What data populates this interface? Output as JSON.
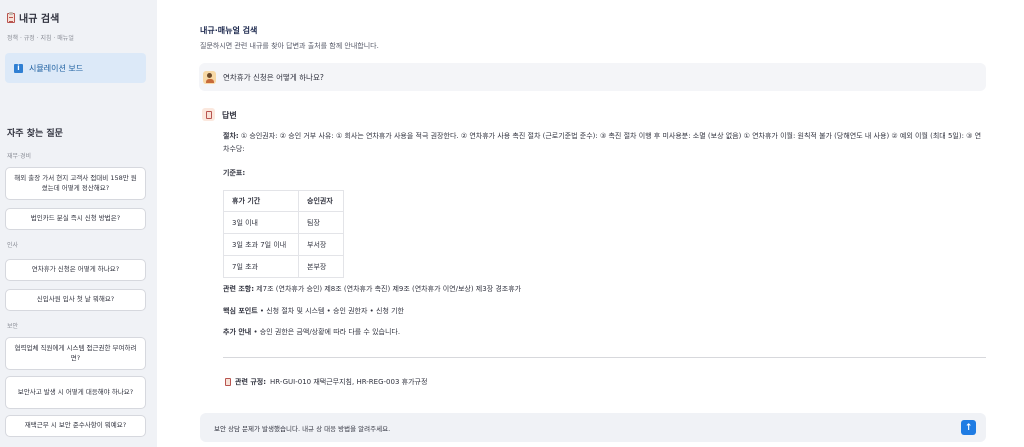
{
  "sidebar": {
    "title": "내규 검색",
    "subtitle": "정책 · 규정 · 지침 · 매뉴얼",
    "sim_board_label": "시뮬레이션 보드",
    "faq_title": "자주 찾는 질문",
    "categories": [
      {
        "name": "재무·경비",
        "items": [
          "해외 출장 가서 현지 고객사 접대비 158만 원 썼는데 어떻게 정산해요?",
          "법인카드 분실 즉시 신청 방법은?"
        ]
      },
      {
        "name": "인사",
        "items": [
          "연차휴가 신청은 어떻게 하나요?",
          "신입사원 입사 첫 날 뭐해요?"
        ]
      },
      {
        "name": "보안",
        "items": [
          "협력업체 직원에게 시스템 접근권한 부여하려면?",
          "보안사고 발생 시 어떻게 대응해야 하나요?",
          "재택근무 시 보안 준수사항이 뭐예요?"
        ]
      }
    ]
  },
  "main": {
    "title": "내규·매뉴얼 검색",
    "subtitle": "질문하시면 관련 내규를 찾아 답변과 출처를 함께 안내합니다.",
    "user_question": "연차휴가 신청은 어떻게 하나요?",
    "answer_heading": "답변",
    "procedure_label": "절차:",
    "procedure_text": "① 승인권자: ② 승인 거부 사유: ① 회사는 연차휴가 사용을 적극 권장한다. ② 연차휴가 사용 촉진 절차 (근로기준법 준수): ③ 촉진 절차 이행 후 미사용분: 소멸 (보상 없음) ① 연차휴가 이월: 원칙적 불가 (당해연도 내 사용) ② 예외 이월 (최대 5일): ③ 연차수당:",
    "criteria_label": "기준표:",
    "table": {
      "headers": [
        "휴가 기간",
        "승인권자"
      ],
      "rows": [
        [
          "3일 이내",
          "팀장"
        ],
        [
          "3일 초과 7일 이내",
          "부서장"
        ],
        [
          "7일 초과",
          "본부장"
        ]
      ]
    },
    "related_articles_label": "관련 조항:",
    "related_articles_text": "제7조 (연차휴가 승인) 제8조 (연차휴가 촉진) 제9조 (연차휴가 이연/보상) 제3장 경조휴가",
    "key_points_label": "핵심 포인트",
    "key_points_text": "• 신청 절차 및 시스템 • 승인 권한자 • 신청 기한",
    "additional_label": "추가 안내",
    "additional_text": "• 승인 권한은 금액/상황에 따라 다를 수 있습니다.",
    "related_rules_label": "관련 규정:",
    "related_rules_text": "HR-GUI-010 재택근무지침, HR-REG-003 휴가규정",
    "input_text": "보안 상담 문제가 발생했습니다. 내규 상 대응 방법을 알려주세요.",
    "send_icon": "arrow-up"
  }
}
